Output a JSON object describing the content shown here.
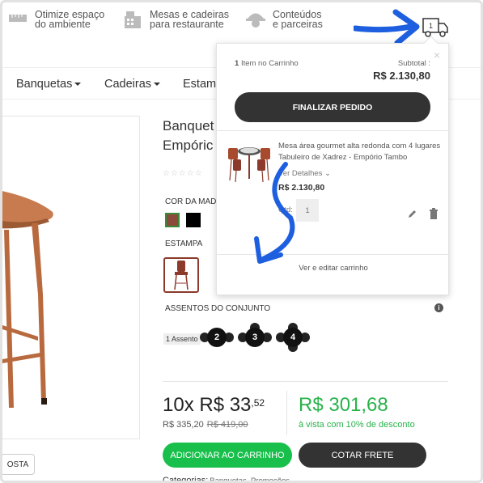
{
  "features": [
    {
      "icon": "ruler-room-icon",
      "line1": "Otimize espaço",
      "line2": "do ambiente"
    },
    {
      "icon": "fax-building-icon",
      "line1": "Mesas e cadeiras",
      "line2": "para restaurante"
    },
    {
      "icon": "worker-helmet-icon",
      "line1": "Conteúdos",
      "line2": "e parceiras"
    }
  ],
  "header": {
    "cart_count": "1"
  },
  "nav": [
    "Banquetas",
    "Cadeiras",
    "Estam"
  ],
  "product": {
    "title_line1": "Banquet",
    "title_line2": "Empóric",
    "stars": "☆☆☆☆☆",
    "color_label": "COR DA MAD",
    "stamp_label": "ESTAMPA",
    "seats_label": "ASSENTOS DO CONJUNTO",
    "seat_1_label": "1 Assento",
    "seat_options": [
      "2",
      "3",
      "4"
    ],
    "installment_main": "10x R$ 33",
    "installment_cents": ",52",
    "price_current": "R$ 335,20",
    "price_old": "R$ 419,00",
    "cash_price": "R$ 301,68",
    "cash_note": "à vista com 10% de desconto",
    "add_to_cart": "ADICIONAR AO CARRINHO",
    "quote_freight": "COTAR FRETE",
    "categories_label": "Categorias:",
    "categories": "Banquetas, Promoções",
    "small_button": "OSTA"
  },
  "cart": {
    "close": "×",
    "items_count": "1",
    "items_text": "Item no Carrinho",
    "subtotal_label": "Subtotal :",
    "subtotal": "R$ 2.130,80",
    "finish_button": "FINALIZAR PEDIDO",
    "item_name": "Mesa área gourmet alta redonda com 4 lugares Tabuleiro de Xadrez - Empório Tambo",
    "details": "Ver Detalhes ⌄",
    "item_price": "R$ 2.130,80",
    "qty_label": "Qtd:",
    "qty": "1",
    "view_edit": "Ver e editar carrinho"
  },
  "colors": {
    "accent_blue": "#1e5fe0",
    "green": "#18c04b",
    "dark": "#333333",
    "wood": "#b86a3e"
  }
}
